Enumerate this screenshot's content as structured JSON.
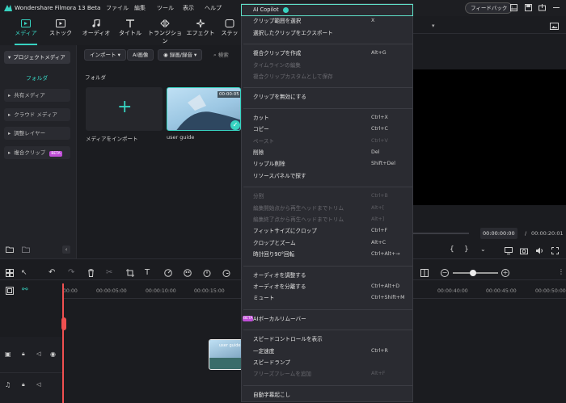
{
  "app": {
    "title": "Wondershare Filmora 13 Beta"
  },
  "menubar": [
    "ファイル",
    "編集",
    "ツール",
    "表示",
    "ヘルプ"
  ],
  "header": {
    "feedback_label": "フィードバック"
  },
  "toolbar": {
    "tabs": [
      {
        "label": "メディア",
        "icon": "media-icon",
        "active": true
      },
      {
        "label": "ストック",
        "icon": "stock-icon"
      },
      {
        "label": "オーディオ",
        "icon": "music-note-icon"
      },
      {
        "label": "タイトル",
        "icon": "title-t-icon"
      },
      {
        "label": "トランジション",
        "icon": "transition-icon"
      },
      {
        "label": "エフェクト",
        "icon": "effect-sparkle-icon"
      },
      {
        "label": "ステッ",
        "icon": "sticker-icon"
      }
    ]
  },
  "sidebar": {
    "project_media": "プロジェクトメディア",
    "folder": "フォルダ",
    "items": [
      "共有メディア",
      "クラウド メディア",
      "調整レイヤー",
      "複合クリップ"
    ],
    "beta_badge": "BETA"
  },
  "media": {
    "import_label": "インポート",
    "ai_image_label": "AI画像",
    "record_label": "録画/録音",
    "search_placeholder": "検索",
    "folder_heading": "フォルダ",
    "import_tile_label": "メディアをインポート",
    "clip_label": "user guide",
    "clip_duration": "00:00:05"
  },
  "viewer": {
    "current_time": "00:00:00:00",
    "separator": "/",
    "total_time": "00:00:20:01"
  },
  "timeline": {
    "ruler": [
      "00:00",
      "00:00:05:00",
      "00:00:10:00",
      "00:00:15:00",
      "00:00:40:00",
      "00:00:45:00",
      "00:00:50:00"
    ],
    "clip_label": "user guide"
  },
  "context_menu": {
    "sections": [
      [
        {
          "label": "AI Copilot",
          "highlight": true
        },
        {
          "label": "クリップ範囲を選択",
          "shortcut": "X"
        },
        {
          "label": "選択したクリップをエクスポート"
        }
      ],
      [
        {
          "label": "複合クリップを作成",
          "shortcut": "Alt+G"
        },
        {
          "label": "タイムラインの編集",
          "disabled": true
        },
        {
          "label": "複合クリップカスタムとして保存",
          "disabled": true
        }
      ],
      [
        {
          "label": "クリップを無効にする"
        }
      ],
      [
        {
          "label": "カット",
          "shortcut": "Ctrl+X"
        },
        {
          "label": "コピー",
          "shortcut": "Ctrl+C"
        },
        {
          "label": "ペースト",
          "shortcut": "Ctrl+V",
          "disabled": true
        },
        {
          "label": "削除",
          "shortcut": "Del"
        },
        {
          "label": "リップル削除",
          "shortcut": "Shift+Del"
        },
        {
          "label": "リソースパネルで探す"
        }
      ],
      [
        {
          "label": "分割",
          "shortcut": "Ctrl+B",
          "disabled": true
        },
        {
          "label": "編集開始点から再生ヘッドまでトリム",
          "shortcut": "Alt+[",
          "disabled": true
        },
        {
          "label": "編集終了点から再生ヘッドまでトリム",
          "shortcut": "Alt+]",
          "disabled": true
        },
        {
          "label": "フィットサイズにクロップ",
          "shortcut": "Ctrl+F"
        },
        {
          "label": "クロップとズーム",
          "shortcut": "Alt+C"
        },
        {
          "label": "時計回り90°回転",
          "shortcut": "Ctrl+Alt+→"
        }
      ],
      [
        {
          "label": "オーディオを調整する"
        },
        {
          "label": "オーディオを分離する",
          "shortcut": "Ctrl+Alt+D"
        },
        {
          "label": "ミュート",
          "shortcut": "Ctrl+Shift+M"
        }
      ],
      [
        {
          "label": "AIボーカルリムーバー",
          "badge": "BETA"
        }
      ],
      [
        {
          "label": "スピードコントロールを表示"
        },
        {
          "label": "一定速度",
          "shortcut": "Ctrl+R"
        },
        {
          "label": "スピードランプ"
        },
        {
          "label": "フリーズフレームを追加",
          "shortcut": "Alt+F",
          "disabled": true
        }
      ],
      [
        {
          "label": "自動字幕起こし"
        }
      ]
    ]
  },
  "colors": {
    "accent": "#37d3c1",
    "highlight_border": "#5fe0c8",
    "beta_badge": "#c04fd8"
  }
}
